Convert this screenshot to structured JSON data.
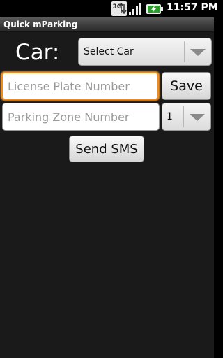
{
  "status_bar": {
    "network_type": "3G",
    "time": "11:57 PM",
    "icons": [
      "3g-data-icon",
      "signal-strength-icon",
      "battery-charging-icon"
    ]
  },
  "app": {
    "title": "Quick mParking"
  },
  "car": {
    "label": "Car:",
    "selected": "Select Car"
  },
  "plate": {
    "value": "",
    "placeholder": "License Plate Number",
    "focused": true
  },
  "save": {
    "label": "Save"
  },
  "zone": {
    "value": "",
    "placeholder": "Parking Zone Number",
    "selected": "1"
  },
  "send": {
    "label": "Send SMS"
  },
  "colors": {
    "background": "#1a1a1a",
    "focus_accent": "#f08c1c",
    "title_bar": "#3c3c3c"
  }
}
